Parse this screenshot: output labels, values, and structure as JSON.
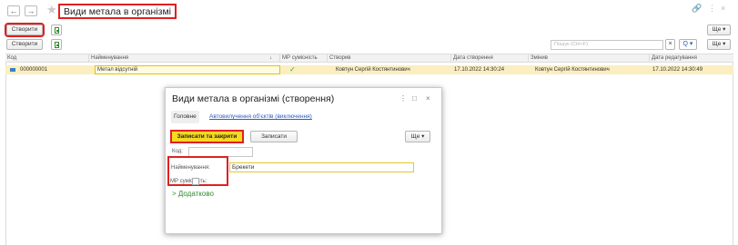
{
  "window": {
    "title": "Види метала в організмі",
    "back_icon": "←",
    "forward_icon": "→",
    "link_icon": "🔗",
    "more_icon": "⋮",
    "close_icon": "×"
  },
  "toolbar_top": {
    "create_label": "Створити",
    "more_label": "Ще ▾"
  },
  "toolbar_list": {
    "create_label": "Створити",
    "search_placeholder": "Пошук (Ctrl+F)",
    "clear_icon": "×",
    "search_icon": "Q ▾",
    "more_label": "Ще ▾"
  },
  "table": {
    "columns": [
      "Код",
      "Найменування",
      "МР сумісність",
      "Створив",
      "Дата створення",
      "Змінив",
      "Дата редагування"
    ],
    "sort_icon": "↓",
    "rows": [
      {
        "code": "000000001",
        "name": "Метал відсутній",
        "mr_compat": "✓",
        "created_by": "Ковтун Сергій Костянтинович",
        "created_date": "17.10.2022 14:30:24",
        "changed_by": "Ковтун Сергій Костянтинович",
        "changed_date": "17.10.2022 14:30:49"
      }
    ]
  },
  "dialog": {
    "title": "Види метала в організмі (створення)",
    "more_icon": "⋮",
    "maximize_icon": "□",
    "close_icon": "×",
    "tabs": [
      "Головне",
      "Автовилучення об'єктів (виключення)"
    ],
    "save_close_label": "Записати та закрити",
    "save_label": "Записати",
    "more_label": "Ще ▾",
    "fields": {
      "code_label": "Код:",
      "code_value": "",
      "name_label": "Найменування:",
      "name_value": "Брекети",
      "mr_label": "МР сумісність:"
    },
    "additional_label": "> Додатково"
  },
  "colors": {
    "highlight": "#e02020",
    "primary_button": "#f5d922",
    "selected_row": "#fbeec0",
    "link": "#2a5bb8",
    "check": "#3aa33a"
  }
}
